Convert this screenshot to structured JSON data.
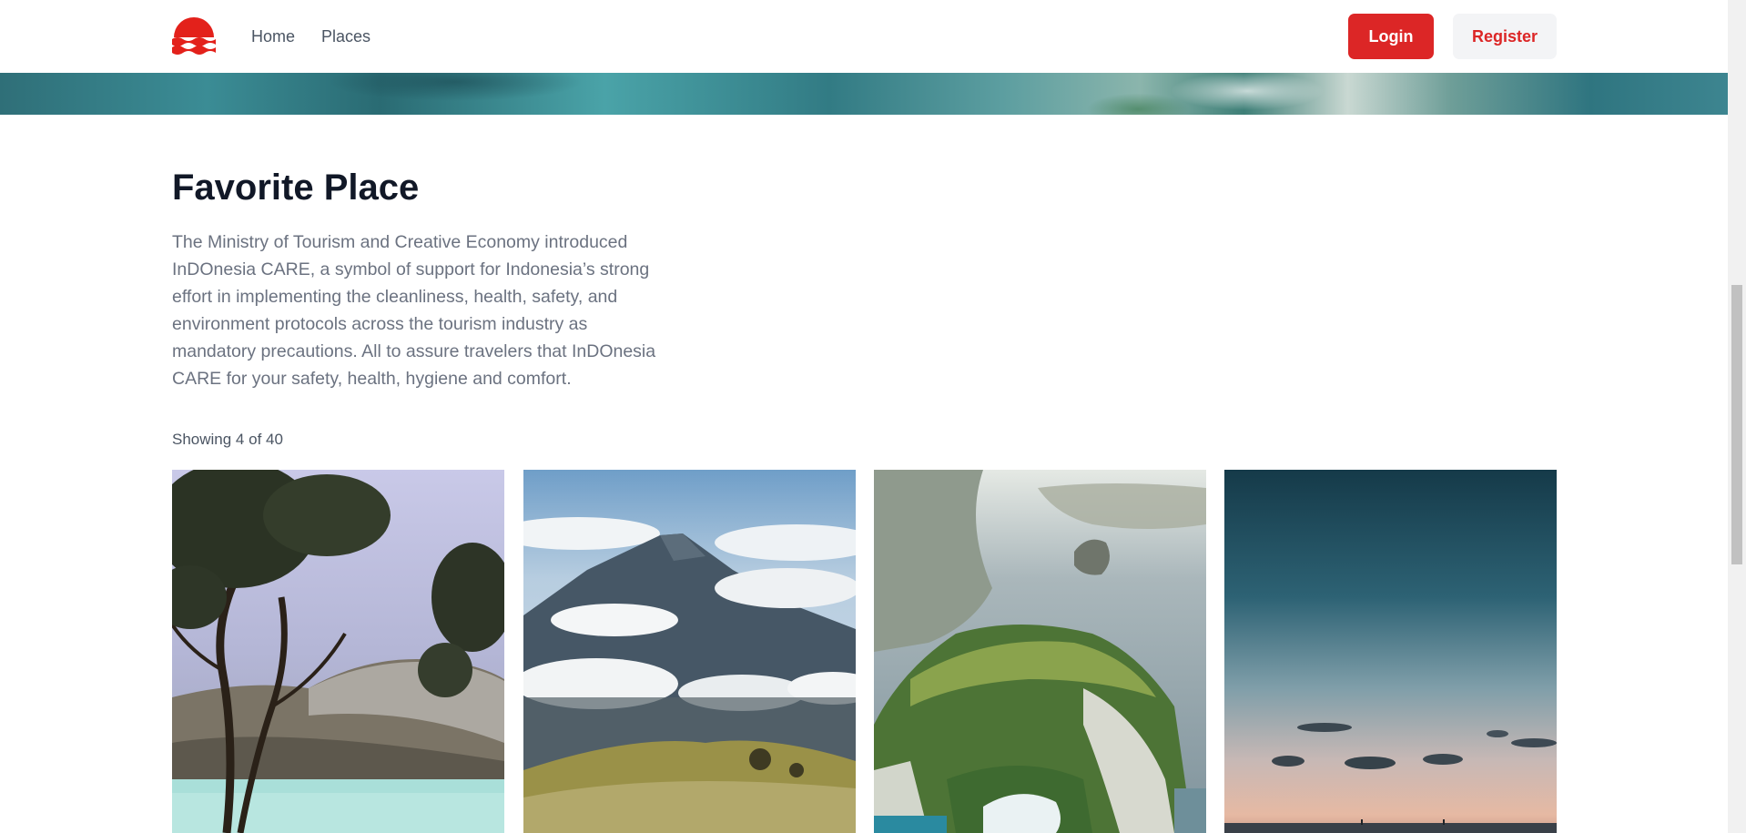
{
  "nav": {
    "links": [
      "Home",
      "Places"
    ],
    "login_label": "Login",
    "register_label": "Register",
    "logo_icon": "waves-sun-logo-icon"
  },
  "colors": {
    "brand_red": "#dc2626",
    "heading": "#111827",
    "body_text": "#6b7280"
  },
  "section": {
    "title": "Favorite Place",
    "description": "The Ministry of Tourism and Creative Economy introduced InDOnesia CARE, a symbol of support for Indonesia’s strong effort in implementing the cleanliness, health, safety, and environment protocols across the tourism industry as mandatory precautions. All to assure travelers that InDOnesia CARE for your safety, health, hygiene and comfort.",
    "showing": "Showing 4 of 40"
  }
}
